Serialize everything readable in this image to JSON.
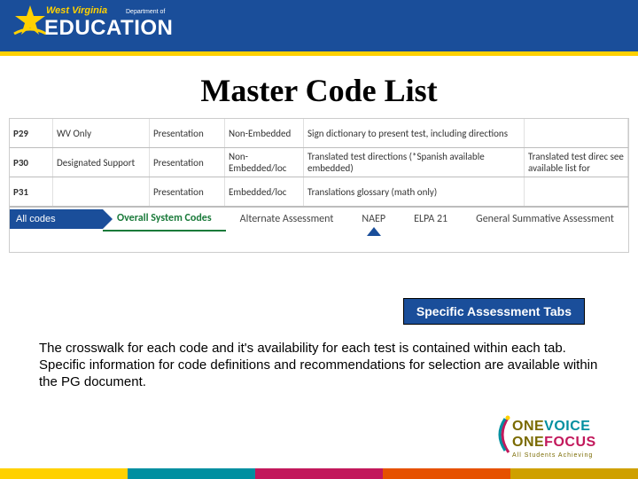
{
  "header": {
    "logo_top": "West Virginia",
    "logo_sub": "Department of",
    "logo_main": "EDUCATION"
  },
  "title": "Master Code List",
  "rows": [
    {
      "code": "P29",
      "wv": "WV Only",
      "pres": "Presentation",
      "emb": "Non-Embedded",
      "desc": "Sign dictionary to present test, including directions",
      "extra": ""
    },
    {
      "code": "P30",
      "wv": "Designated Support",
      "pres": "Presentation",
      "emb": "Non-Embedded/loc",
      "desc": "Translated test directions (*Spanish available embedded)",
      "extra": "Translated test direc see available list for"
    },
    {
      "code": "P31",
      "wv": "",
      "pres": "Presentation",
      "emb": "Embedded/loc",
      "desc": "Translations glossary (math only)",
      "extra": ""
    }
  ],
  "tabs": {
    "arrow_label": "All codes",
    "items": [
      "Overall System Codes",
      "Alternate Assessment",
      "NAEP",
      "ELPA 21",
      "General Summative Assessment"
    ]
  },
  "callout": "Specific Assessment Tabs",
  "body": "The crosswalk for each code and it's availability for each test is contained within each tab.\nSpecific information for code definitions and recommendations for selection are available within the PG document.",
  "footer_logo": {
    "word_one": "ONE",
    "word_voice": "VOICE",
    "word_focus": "FOCUS",
    "tagline": "All Students Achieving"
  }
}
